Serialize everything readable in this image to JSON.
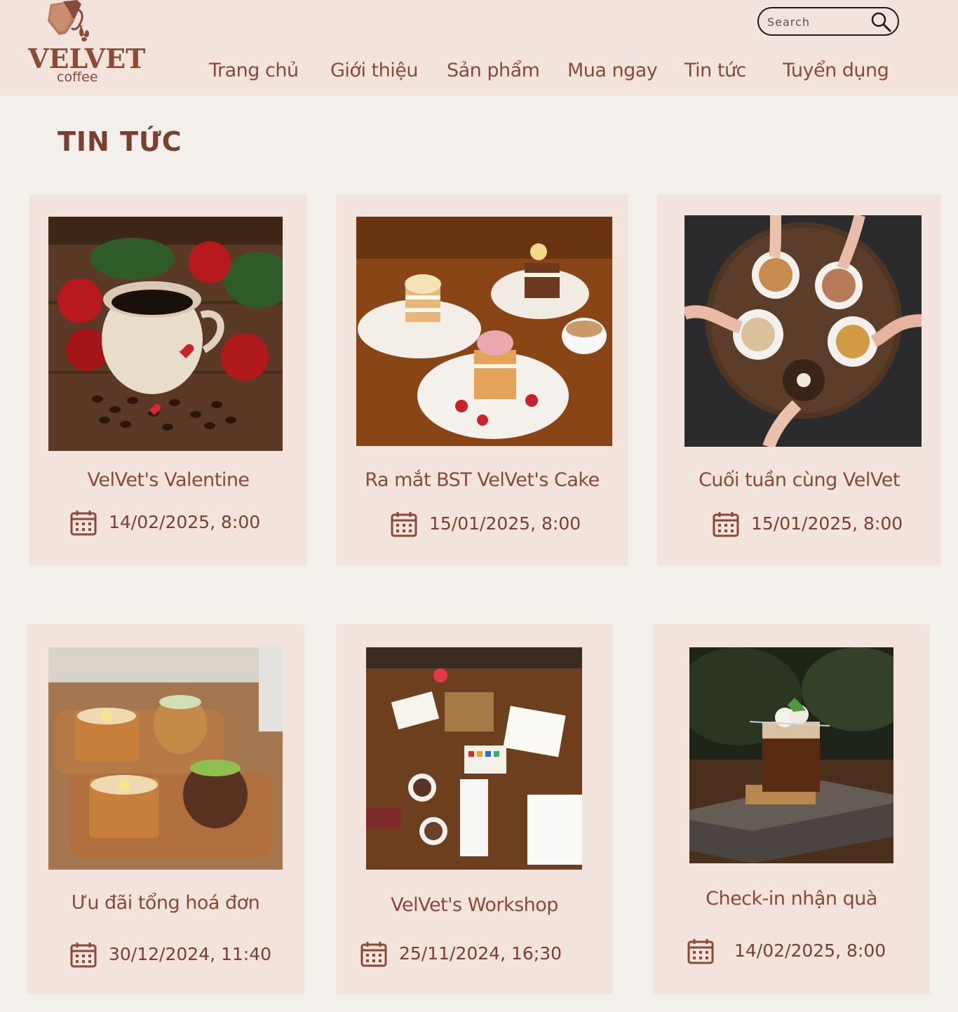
{
  "brand": {
    "name": "VELVET",
    "sub": "coffee"
  },
  "search": {
    "placeholder": "Search"
  },
  "nav": [
    {
      "label": "Trang chủ"
    },
    {
      "label": "Giới thiệu"
    },
    {
      "label": "Sản phẩm"
    },
    {
      "label": "Mua ngay"
    },
    {
      "label": "Tin tức"
    },
    {
      "label": "Tuyển dụng"
    }
  ],
  "page_title": "TIN TỨC",
  "articles": [
    {
      "title": "VelVet's Valentine",
      "date": "14/02/2025, 8:00",
      "image": "coffee-cup-roses-photo"
    },
    {
      "title": "Ra mắt BST VelVet's Cake",
      "date": "15/01/2025, 8:00",
      "image": "cakes-plates-photo"
    },
    {
      "title": "Cuối tuần cùng VelVet",
      "date": "15/01/2025, 8:00",
      "image": "latte-art-table-photo"
    },
    {
      "title": "Ưu đãi tổng hoá đơn",
      "date": "30/12/2024, 11:40",
      "image": "toast-matcha-photo"
    },
    {
      "title": "VelVet's Workshop",
      "date": "25/11/2024, 16;30",
      "image": "painting-workshop-photo"
    },
    {
      "title": "Check-in nhận quà",
      "date": "14/02/2025, 8:00",
      "image": "iced-coffee-book-photo"
    }
  ],
  "colors": {
    "header_bg": "#f2e3dc",
    "page_bg": "#f3efeb",
    "card_bg": "#f2e3dc",
    "text_brown": "#8a4a37"
  },
  "icons": {
    "search": "magnifier-icon",
    "calendar": "calendar-icon"
  }
}
